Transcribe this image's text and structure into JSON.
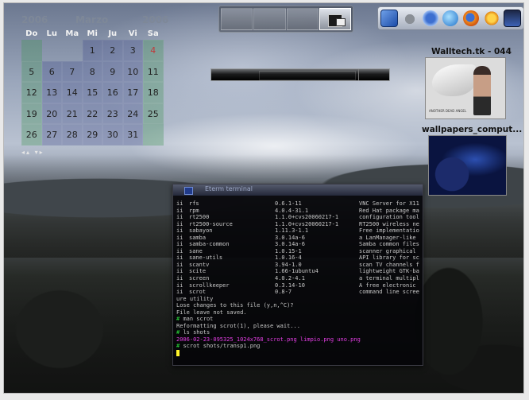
{
  "calendar": {
    "year_left": "2006",
    "month": "Marzo",
    "year_right": "2006",
    "weekdays": [
      "Do",
      "Lu",
      "Ma",
      "Mi",
      "Ju",
      "Vi",
      "Sa"
    ],
    "weeks": [
      [
        "",
        "",
        "",
        "1",
        "2",
        "3",
        "4"
      ],
      [
        "5",
        "6",
        "7",
        "8",
        "9",
        "10",
        "11"
      ],
      [
        "12",
        "13",
        "14",
        "15",
        "16",
        "17",
        "18"
      ],
      [
        "19",
        "20",
        "21",
        "22",
        "23",
        "24",
        "25"
      ],
      [
        "26",
        "27",
        "28",
        "29",
        "30",
        "31",
        ""
      ]
    ],
    "nav": "◂▴ ▾▸"
  },
  "launcher": {
    "icons": [
      "terminal-icon",
      "airplane-icon",
      "mail-at-icon",
      "globe-icon",
      "firefox-icon",
      "star-icon",
      "monitor-icon"
    ]
  },
  "thumbnails": [
    {
      "title": "Walltech.tk - 044",
      "caption": "ANOTHER DEAD ANGEL"
    },
    {
      "title": "wallpapers_comput...",
      "caption": ""
    }
  ],
  "terminal": {
    "title": "Eterm terminal",
    "packages": [
      {
        "status": "ii",
        "name": "rfs",
        "version": "0.6.1-11",
        "desc": "VNC Server for X11"
      },
      {
        "status": "ii",
        "name": "rpm",
        "version": "4.0.4-31.1",
        "desc": "Red Hat package man"
      },
      {
        "status": "ii",
        "name": "rt2500",
        "version": "1.1.0+cvs20060217-1",
        "desc": "configuration tool"
      },
      {
        "status": "ii",
        "name": "rt2500-source",
        "version": "1.1.0+cvs20060217-1",
        "desc": "RT2500 wireless net"
      },
      {
        "status": "ii",
        "name": "sabayon",
        "version": "1.11.3-1.1",
        "desc": "Free implementation"
      },
      {
        "status": "ii",
        "name": "samba",
        "version": "3.0.14a-6",
        "desc": "a LanManager-like f"
      },
      {
        "status": "ii",
        "name": "samba-common",
        "version": "3.0.14a-6",
        "desc": "Samba common files"
      },
      {
        "status": "ii",
        "name": "sane",
        "version": "1.0.15-1",
        "desc": "scanner graphical f"
      },
      {
        "status": "ii",
        "name": "sane-utils",
        "version": "1.0.16-4",
        "desc": "API library for sca"
      },
      {
        "status": "ii",
        "name": "scantv",
        "version": "3.94-1.0",
        "desc": "scan TV channels fo"
      },
      {
        "status": "ii",
        "name": "scite",
        "version": "1.66-1ubuntu4",
        "desc": "lightweight GTK-bas"
      },
      {
        "status": "ii",
        "name": "screen",
        "version": "4.0.2-4.1",
        "desc": "a terminal multiple"
      },
      {
        "status": "ii",
        "name": "scrollkeeper",
        "version": "0.3.14-10",
        "desc": "A free electronic c"
      },
      {
        "status": "ii",
        "name": "scrot",
        "version": "0.8-7",
        "desc": "command line screen"
      }
    ],
    "lines": [
      {
        "text": "ure utility",
        "color": "default"
      },
      {
        "text": "Lose changes to this file (y,n,^C)?",
        "color": "default"
      },
      {
        "text": "File leave not saved.",
        "color": "default"
      },
      {
        "prompt": "#",
        "text": "man scrot",
        "color": "default"
      },
      {
        "text": "Reformatting scrot(1), please wait...",
        "color": "default"
      },
      {
        "prompt": "#",
        "text": "ls shots",
        "color": "default"
      },
      {
        "text": "2006-02-23-095325_1024x768_scrot.png  limpio.png  uno.png",
        "color": "magenta"
      },
      {
        "prompt": "#",
        "text": "scrot shots/transp1.png",
        "color": "default"
      }
    ]
  }
}
